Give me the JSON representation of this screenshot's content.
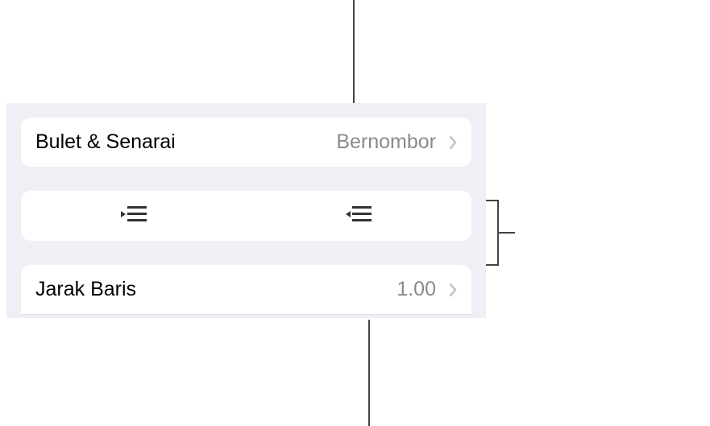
{
  "bullets_row": {
    "label": "Bulet & Senarai",
    "value": "Bernombor"
  },
  "spacing_row": {
    "label": "Jarak Baris",
    "value": "1.00"
  },
  "icons": {
    "outdent": "outdent-icon",
    "indent": "indent-icon",
    "chevron": "chevron-right-icon"
  }
}
